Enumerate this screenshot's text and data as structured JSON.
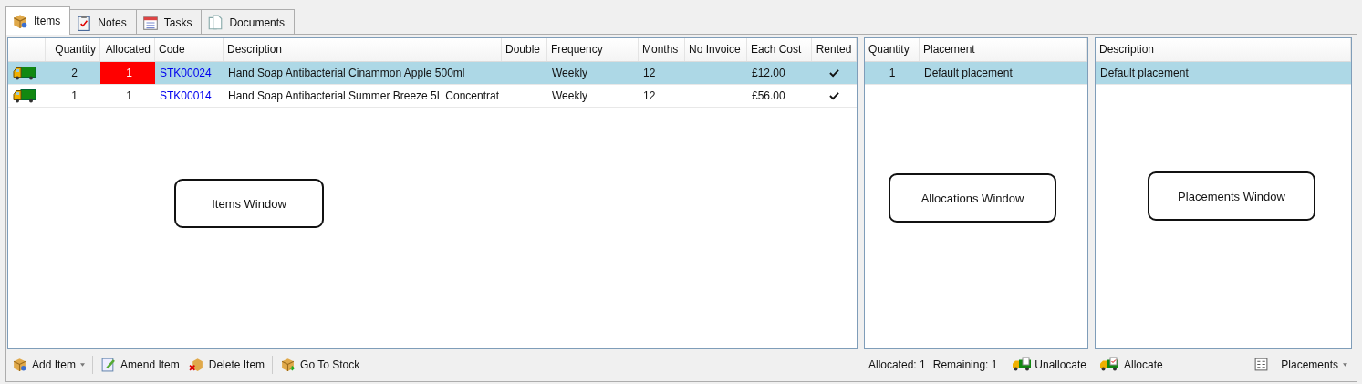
{
  "tabs": [
    {
      "label": "Items",
      "kind": "box",
      "selected": true
    },
    {
      "label": "Notes",
      "kind": "notes",
      "selected": false
    },
    {
      "label": "Tasks",
      "kind": "calendar",
      "selected": false
    },
    {
      "label": "Documents",
      "kind": "document",
      "selected": false
    }
  ],
  "items": {
    "columns": [
      "Quantity",
      "Allocated",
      "Code",
      "Description",
      "Double",
      "Frequency",
      "Months",
      "No Invoice",
      "Each Cost",
      "Rented"
    ],
    "rows": [
      {
        "quantity": "2",
        "allocated": "1",
        "allocated_alert": true,
        "code": "STK00024",
        "description": "Hand Soap Antibacterial Cinammon Apple 500ml",
        "frequency": "Weekly",
        "months": "12",
        "each_cost": "£12.00",
        "rented": true,
        "selected": true
      },
      {
        "quantity": "1",
        "allocated": "1",
        "allocated_alert": false,
        "code": "STK00014",
        "description": "Hand Soap Antibacterial Summer Breeze 5L Concentrat",
        "frequency": "Weekly",
        "months": "12",
        "each_cost": "£56.00",
        "rented": true,
        "selected": false
      }
    ],
    "callout": "Items Window",
    "toolbar": [
      [
        {
          "label": "Add Item",
          "kind": "add",
          "dropdown": true
        }
      ],
      [
        {
          "label": "Amend Item",
          "kind": "edit",
          "dropdown": false
        },
        {
          "label": "Delete Item",
          "kind": "delete",
          "dropdown": false
        }
      ],
      [
        {
          "label": "Go To Stock",
          "kind": "stock",
          "dropdown": false
        }
      ]
    ]
  },
  "allocations": {
    "columns": [
      "Quantity",
      "Placement"
    ],
    "rows": [
      {
        "quantity": "1",
        "placement": "Default placement",
        "selected": true
      }
    ],
    "callout": "Allocations Window",
    "summary": [
      "Allocated: 1",
      "Remaining: 1"
    ],
    "button": "Unallocate"
  },
  "placements": {
    "columns": [
      "Description"
    ],
    "rows": [
      {
        "description": "Default placement",
        "selected": true
      }
    ],
    "callout": "Placements Window",
    "allocate_button": "Allocate",
    "placements_button": "Placements"
  }
}
